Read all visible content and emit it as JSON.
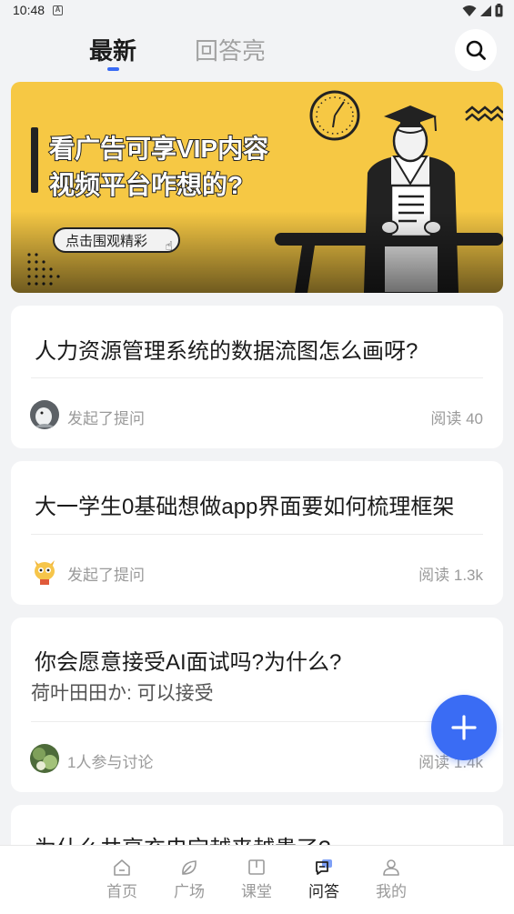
{
  "status_bar": {
    "time": "10:48",
    "notification_letter": "A"
  },
  "header": {
    "tabs": [
      {
        "label": "最新",
        "active": true
      },
      {
        "label": "回答亮",
        "active": false
      }
    ],
    "search_icon": "search-icon"
  },
  "banner": {
    "line1": "看广告可享VIP内容",
    "line2": "视频平台咋想的?",
    "cta": "点击围观精彩",
    "bg_color": "#f6c844"
  },
  "questions": [
    {
      "title": "人力资源管理系统的数据流图怎么画呀?",
      "meta": "发起了提问",
      "reads": "阅读 40"
    },
    {
      "title": "大一学生0基础想做app界面要如何梳理框架",
      "meta": "发起了提问",
      "reads": "阅读 1.3k"
    },
    {
      "title": "你会愿意接受AI面试吗?为什么?",
      "answer": "荷叶田田か: 可以接受",
      "meta": "1人参与讨论",
      "reads": "阅读 1.4k"
    },
    {
      "title": "为什么共享充电宝越来越贵了?"
    }
  ],
  "fab": {
    "icon": "plus-icon",
    "color": "#3a6cf4"
  },
  "bottom_nav": [
    {
      "label": "首页",
      "icon": "home-icon",
      "active": false
    },
    {
      "label": "广场",
      "icon": "leaf-icon",
      "active": false
    },
    {
      "label": "课堂",
      "icon": "book-icon",
      "active": false
    },
    {
      "label": "问答",
      "icon": "chat-icon",
      "active": true
    },
    {
      "label": "我的",
      "icon": "user-icon",
      "active": false
    }
  ],
  "accent_color": "#3a6cf4"
}
